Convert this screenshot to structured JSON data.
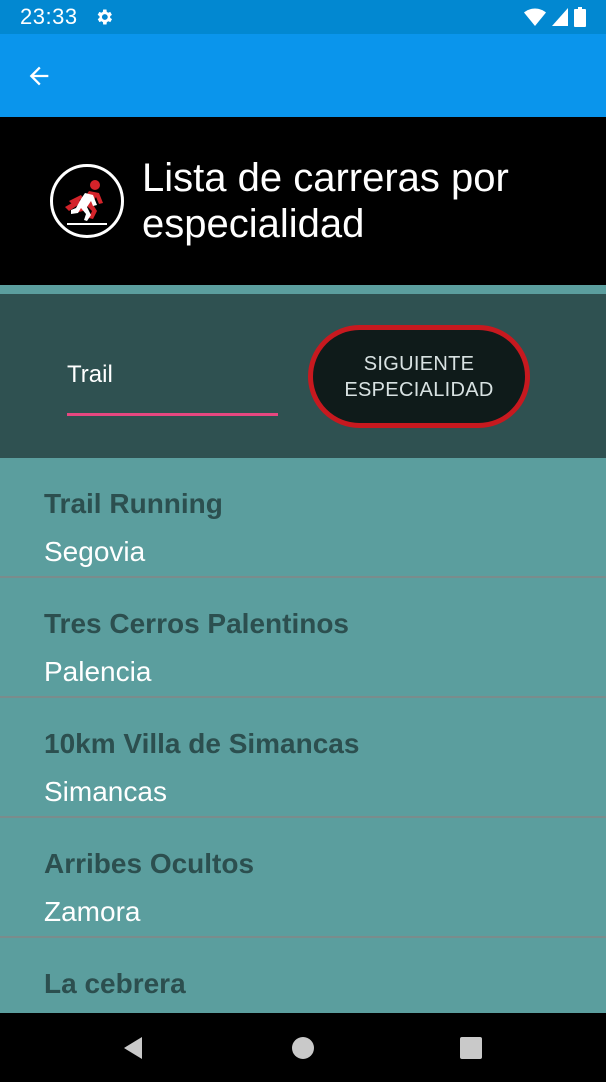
{
  "status_bar": {
    "time": "23:33",
    "icons": [
      "gear-icon",
      "wifi-icon",
      "signal-icon",
      "battery-icon"
    ]
  },
  "app_bar": {
    "back_icon": "arrow-back-icon",
    "color": "#0a95ec"
  },
  "header": {
    "logo_icon": "runner-logo-icon",
    "title": "Lista de carreras por especialidad"
  },
  "filter": {
    "input_value": "Trail",
    "next_button_label": "SIGUIENTE ESPECIALIDAD",
    "accent": "#e74780",
    "button_border": "#c7191f"
  },
  "races": [
    {
      "name": "Trail Running",
      "city": "Segovia"
    },
    {
      "name": "Tres Cerros Palentinos",
      "city": "Palencia"
    },
    {
      "name": "10km Villa de Simancas",
      "city": "Simancas"
    },
    {
      "name": "Arribes Ocultos",
      "city": "Zamora"
    },
    {
      "name": "La cebrera",
      "city": ""
    }
  ],
  "nav_bar": {
    "icons": [
      "nav-back-icon",
      "nav-home-icon",
      "nav-recents-icon"
    ]
  }
}
